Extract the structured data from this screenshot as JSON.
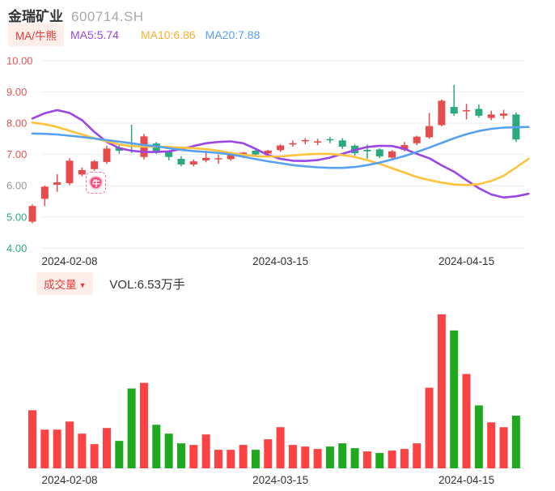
{
  "header": {
    "title": "金瑞矿业",
    "code": "600714.SH"
  },
  "legend": {
    "ma_badge": "MA/牛熊",
    "ma5": "MA5:5.74",
    "ma10": "MA10:6.86",
    "ma20": "MA20:7.88"
  },
  "volume_header": {
    "badge": "成交量",
    "badge_arrow": "▼",
    "vol_label": "VOL:6.53万手"
  },
  "colors": {
    "up": "#e64c4c",
    "down": "#2aa87e",
    "vol_up": "#fb4343",
    "vol_down": "#1fa91f",
    "ma5": "#9b45e4",
    "ma10": "#ffc23d",
    "ma20": "#57a1ef",
    "axis_red": "#e05555",
    "axis_green": "#2fa982",
    "axis_gray": "#999999",
    "grid": "#e9edf4",
    "baseline": "#dde2e9",
    "text_dark": "#333333"
  },
  "chart_data": [
    {
      "type": "candlestick",
      "title": "金瑞矿业 600714.SH 日K线",
      "ylim": [
        4,
        10
      ],
      "grid": true,
      "y_ticks": [
        {
          "label": "10.00",
          "v": 10,
          "tone": "red"
        },
        {
          "label": "9.00",
          "v": 9,
          "tone": "red"
        },
        {
          "label": "8.00",
          "v": 8,
          "tone": "red"
        },
        {
          "label": "7.00",
          "v": 7,
          "tone": "red"
        },
        {
          "label": "6.00",
          "v": 6,
          "tone": "gray"
        },
        {
          "label": "5.00",
          "v": 5,
          "tone": "green"
        },
        {
          "label": "4.00",
          "v": 4,
          "tone": "green"
        }
      ],
      "x_ticks": [
        {
          "label": "2024-02-08",
          "i": 3
        },
        {
          "label": "2024-03-15",
          "i": 20
        },
        {
          "label": "2024-04-15",
          "i": 35
        }
      ],
      "candles": [
        [
          4.85,
          5.35,
          5.4,
          4.8
        ],
        [
          5.58,
          5.97,
          6.0,
          5.35
        ],
        [
          6.03,
          6.11,
          6.37,
          5.8
        ],
        [
          6.08,
          6.8,
          6.88,
          6.02
        ],
        [
          6.36,
          6.5,
          6.58,
          6.3
        ],
        [
          6.53,
          6.78,
          6.82,
          6.48
        ],
        [
          6.76,
          7.19,
          7.28,
          6.7
        ],
        [
          7.22,
          7.12,
          7.3,
          7.02
        ],
        [
          7.28,
          7.24,
          7.95,
          7.05
        ],
        [
          6.92,
          7.58,
          7.66,
          6.84
        ],
        [
          7.35,
          7.08,
          7.4,
          7.02
        ],
        [
          7.08,
          6.92,
          7.12,
          6.81
        ],
        [
          6.86,
          6.68,
          6.94,
          6.62
        ],
        [
          6.68,
          6.78,
          6.84,
          6.62
        ],
        [
          6.81,
          6.89,
          7.12,
          6.75
        ],
        [
          6.85,
          6.88,
          7.0,
          6.7
        ],
        [
          6.85,
          7.0,
          7.04,
          6.8
        ],
        [
          6.97,
          7.06,
          7.08,
          6.88
        ],
        [
          7.12,
          7.0,
          7.15,
          6.95
        ],
        [
          7.03,
          7.12,
          7.15,
          6.92
        ],
        [
          7.14,
          7.29,
          7.32,
          7.08
        ],
        [
          7.32,
          7.36,
          7.45,
          7.25
        ],
        [
          7.42,
          7.46,
          7.52,
          7.33
        ],
        [
          7.38,
          7.42,
          7.5,
          7.3
        ],
        [
          7.49,
          7.46,
          7.56,
          7.36
        ],
        [
          7.45,
          7.25,
          7.52,
          7.18
        ],
        [
          7.28,
          7.04,
          7.32,
          6.96
        ],
        [
          7.15,
          7.1,
          7.32,
          6.86
        ],
        [
          7.16,
          6.94,
          7.2,
          6.88
        ],
        [
          6.9,
          7.1,
          7.14,
          6.82
        ],
        [
          7.15,
          7.3,
          7.4,
          7.1
        ],
        [
          7.36,
          7.57,
          7.6,
          7.3
        ],
        [
          7.55,
          7.91,
          8.33,
          7.5
        ],
        [
          7.94,
          8.72,
          8.76,
          7.9
        ],
        [
          8.52,
          8.31,
          9.23,
          8.24
        ],
        [
          8.38,
          8.42,
          8.62,
          8.12
        ],
        [
          8.46,
          8.24,
          8.6,
          8.18
        ],
        [
          8.17,
          8.28,
          8.4,
          8.1
        ],
        [
          8.24,
          8.31,
          8.43,
          8.14
        ],
        [
          8.28,
          7.48,
          8.35,
          7.4
        ]
      ],
      "series": [
        {
          "name": "MA5",
          "value": 5.74,
          "color_key": "ma5",
          "points": [
            8.15,
            8.32,
            8.42,
            8.33,
            8.1,
            7.72,
            7.4,
            7.2,
            7.12,
            7.08,
            7.08,
            7.1,
            7.17,
            7.27,
            7.36,
            7.4,
            7.42,
            7.36,
            7.18,
            6.98,
            6.86,
            6.8,
            6.79,
            6.82,
            6.9,
            7.02,
            7.14,
            7.24,
            7.28,
            7.27,
            7.18,
            7.02,
            6.88,
            6.65,
            6.45,
            6.18,
            5.92,
            5.72,
            5.62,
            5.66,
            5.74
          ]
        },
        {
          "name": "MA10",
          "value": 6.86,
          "color_key": "ma10",
          "points": [
            8.02,
            7.97,
            7.88,
            7.76,
            7.64,
            7.52,
            7.42,
            7.32,
            7.27,
            7.25,
            7.25,
            7.24,
            7.22,
            7.2,
            7.17,
            7.12,
            7.05,
            6.99,
            6.95,
            6.93,
            6.94,
            6.97,
            7.0,
            7.02,
            7.02,
            6.98,
            6.92,
            6.82,
            6.7,
            6.56,
            6.42,
            6.28,
            6.18,
            6.1,
            6.04,
            6.02,
            6.05,
            6.15,
            6.32,
            6.58,
            6.86
          ]
        },
        {
          "name": "MA20",
          "value": 7.88,
          "color_key": "ma20",
          "points": [
            7.67,
            7.66,
            7.64,
            7.6,
            7.56,
            7.51,
            7.46,
            7.41,
            7.36,
            7.3,
            7.26,
            7.2,
            7.15,
            7.11,
            7.08,
            7.05,
            7.0,
            6.93,
            6.85,
            6.78,
            6.72,
            6.66,
            6.62,
            6.59,
            6.57,
            6.57,
            6.6,
            6.66,
            6.74,
            6.84,
            6.95,
            7.08,
            7.22,
            7.37,
            7.52,
            7.65,
            7.75,
            7.82,
            7.86,
            7.87,
            7.88
          ]
        }
      ],
      "marker": {
        "label": "牛",
        "i": 5.15,
        "v": 6.12
      }
    },
    {
      "type": "bar",
      "title": "成交量 (万手)",
      "unit": "万手",
      "latest_label": "VOL:6.53万手",
      "x_ticks": [
        {
          "label": "2024-02-08",
          "i": 3
        },
        {
          "label": "2024-03-15",
          "i": 20
        },
        {
          "label": "2024-04-15",
          "i": 35
        }
      ],
      "values": [
        7.2,
        4.8,
        4.8,
        5.8,
        4.3,
        3.0,
        5.0,
        3.4,
        9.9,
        10.6,
        5.4,
        4.3,
        3.1,
        2.9,
        4.2,
        2.3,
        2.3,
        2.9,
        2.3,
        3.6,
        5.1,
        2.9,
        2.7,
        2.4,
        2.7,
        3.1,
        2.5,
        2.1,
        1.9,
        2.2,
        2.4,
        3.1,
        10.0,
        19.1,
        17.1,
        11.7,
        7.8,
        5.7,
        5.1,
        6.53
      ],
      "bar_colors": [
        "r",
        "r",
        "r",
        "r",
        "r",
        "r",
        "r",
        "g",
        "g",
        "r",
        "g",
        "g",
        "g",
        "r",
        "r",
        "r",
        "r",
        "r",
        "g",
        "r",
        "r",
        "r",
        "r",
        "r",
        "g",
        "g",
        "g",
        "r",
        "g",
        "r",
        "r",
        "r",
        "r",
        "r",
        "g",
        "r",
        "g",
        "r",
        "r",
        "g"
      ]
    }
  ]
}
